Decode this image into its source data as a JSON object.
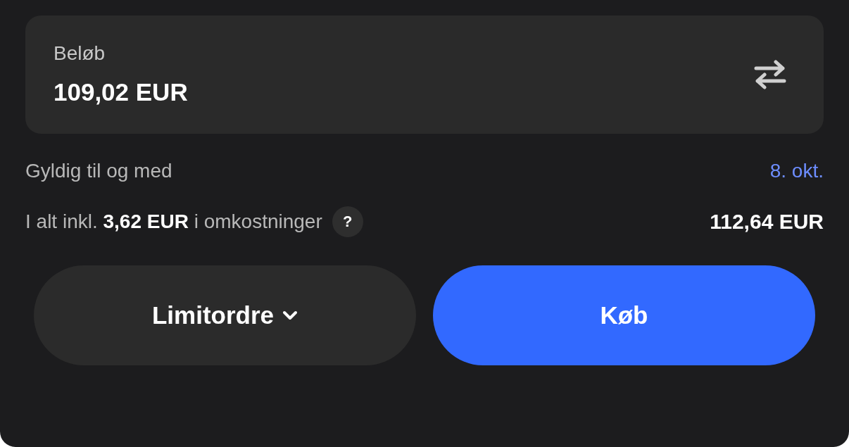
{
  "amount_card": {
    "label": "Beløb",
    "value": "109,02 EUR"
  },
  "validity": {
    "label": "Gyldig til og med",
    "value": "8. okt."
  },
  "total": {
    "label": "I alt inkl. **3,62 EUR** i omkostninger",
    "help": "?",
    "value": "112,64 EUR"
  },
  "buttons": [
    {
      "kind": "dropdown",
      "label": "Limitordre"
    },
    {
      "kind": "primary",
      "label": "Køb"
    }
  ]
}
